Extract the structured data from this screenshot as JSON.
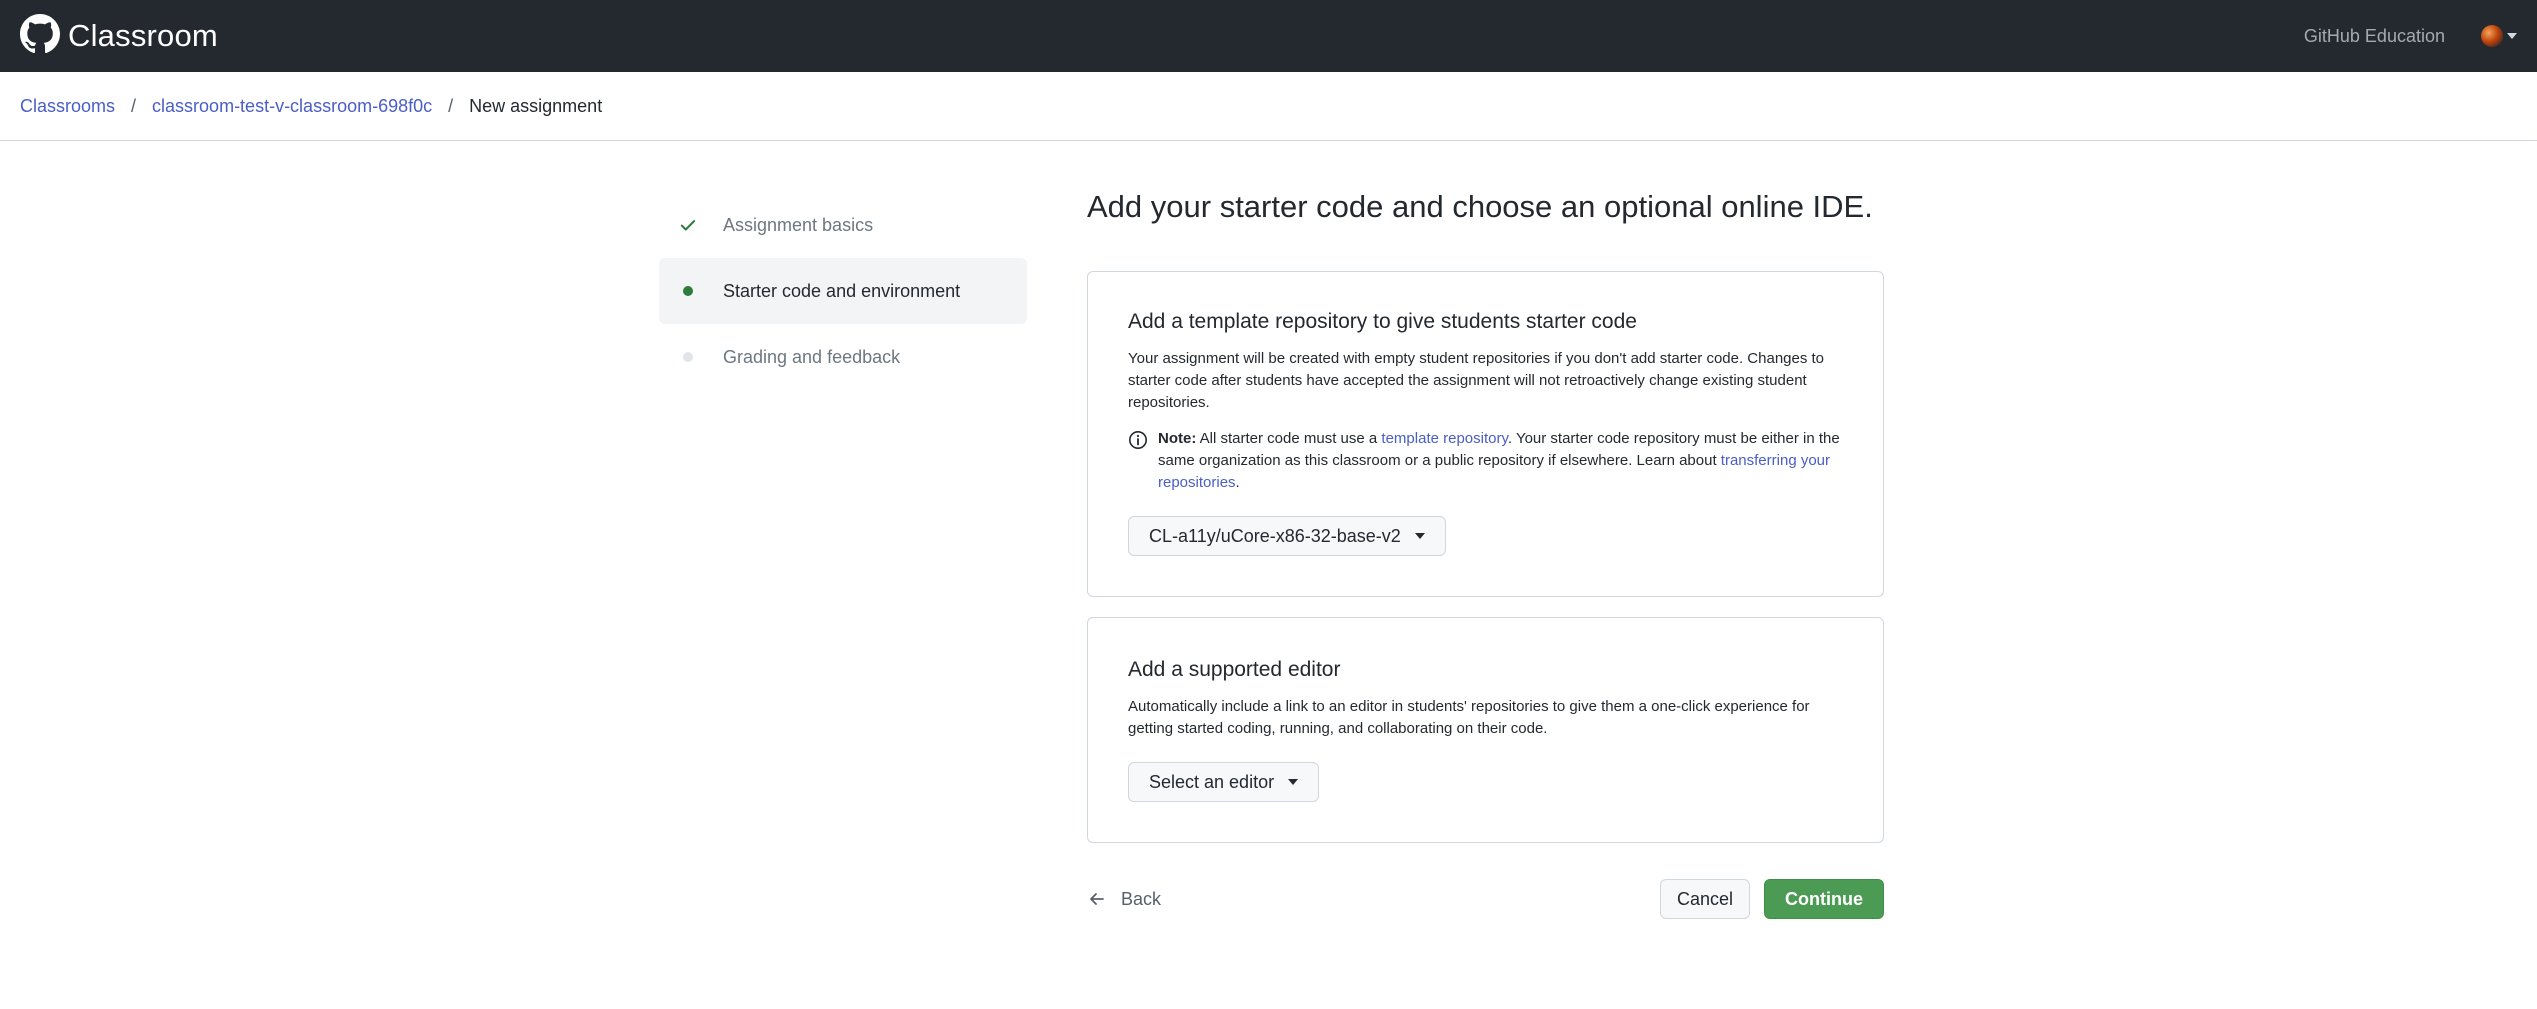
{
  "header": {
    "brand": "Classroom",
    "education_link": "GitHub Education",
    "icons": {
      "logo": "github-octocat-icon",
      "avatar": "user-avatar",
      "menu_caret": "chevron-down-icon"
    }
  },
  "breadcrumb": {
    "items": [
      {
        "label": "Classrooms",
        "link": true
      },
      {
        "label": "classroom-test-v-classroom-698f0c",
        "link": true
      },
      {
        "label": "New assignment",
        "link": false
      }
    ],
    "separator": "/"
  },
  "steps": [
    {
      "label": "Assignment basics",
      "state": "done"
    },
    {
      "label": "Starter code and environment",
      "state": "active"
    },
    {
      "label": "Grading and feedback",
      "state": "todo"
    }
  ],
  "main": {
    "title": "Add your starter code and choose an optional online IDE.",
    "template_card": {
      "title": "Add a template repository to give students starter code",
      "description": "Your assignment will be created with empty student repositories if you don't add starter code. Changes to starter code after students have accepted the assignment will not retroactively change existing student repositories.",
      "note_label": "Note:",
      "note_text_1": " All starter code must use a ",
      "note_link_1": "template repository",
      "note_text_2": ". Your starter code repository must be either in the same organization as this classroom or a public repository if elsewhere. Learn about ",
      "note_link_2": "transferring your repositories",
      "note_text_3": ".",
      "selected_repo": "CL-a11y/uCore-x86-32-base-v2"
    },
    "editor_card": {
      "title": "Add a supported editor",
      "description": "Automatically include a link to an editor in students' repositories to give them a one-click experience for getting started coding, running, and collaborating on their code.",
      "select_label": "Select an editor"
    },
    "footer": {
      "back_label": "Back",
      "cancel_label": "Cancel",
      "continue_label": "Continue"
    }
  },
  "colors": {
    "header_bg": "#24292f",
    "link": "#4a5ec6",
    "primary_button": "#4c9b54",
    "active_step_dot": "#2d7d3a"
  }
}
